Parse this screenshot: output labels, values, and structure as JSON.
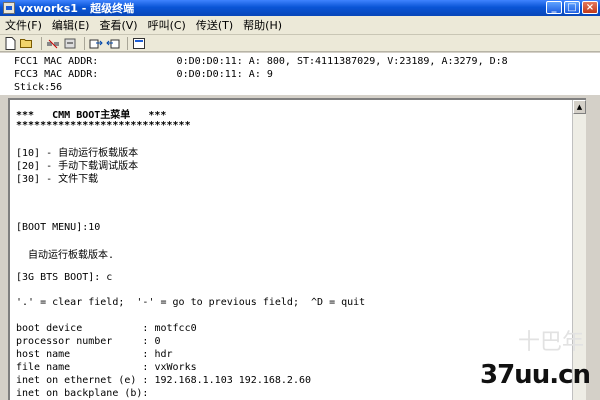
{
  "window": {
    "title": "vxworks1 - 超级终端",
    "minimize": "_",
    "maximize": "□",
    "close": "×"
  },
  "menu": [
    "文件(F)",
    "编辑(E)",
    "查看(V)",
    "呼叫(C)",
    "传送(T)",
    "帮助(H)"
  ],
  "toolbar_icons": [
    "new-icon",
    "open-icon",
    "disconnect-icon",
    "connect-icon",
    "send-icon",
    "receive-icon",
    "properties-icon"
  ],
  "status": {
    "line1": "FCC1 MAC ADDR:             0:D0:D0:11: A: 800, ST:4111387029, V:23189, A:3279, D:8",
    "line2": "FCC3 MAC ADDR:             0:D0:D0:11: A: 9",
    "line3": "Stick:56"
  },
  "terminal": {
    "header": "***   CMM BOOT主菜单   ***",
    "stars": "*****************************",
    "opt1": "[10] - 自动运行板载版本",
    "opt2": "[20] - 手动下载调试版本",
    "opt3": "[30] - 文件下载",
    "boot_menu": "[BOOT MENU]:10",
    "auto_run": "  自动运行板载版本.",
    "bts_boot": "[3G BTS BOOT]: c",
    "help": "'.' = clear field;  '-' = go to previous field;  ^D = quit",
    "params": [
      "boot device          : motfcc0",
      "processor number     : 0",
      "host name            : hdr",
      "file name            : vxWorks",
      "inet on ethernet (e) : 192.168.1.103 192.168.2.60",
      "inet on backplane (b):"
    ]
  },
  "watermark": {
    "main": "37uu.cn",
    "faint": "十巴年"
  }
}
